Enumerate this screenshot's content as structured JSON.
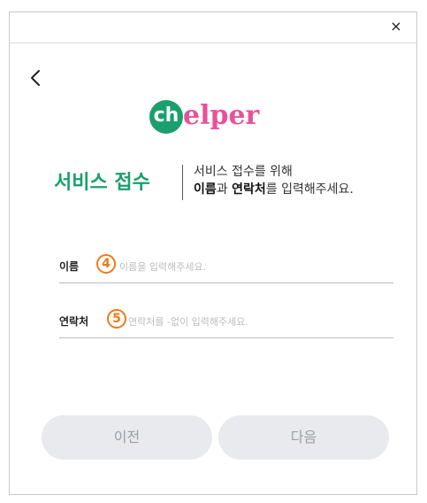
{
  "window": {
    "close_label": "×"
  },
  "logo": {
    "badge_text": "ch",
    "rest_text": "elper"
  },
  "header": {
    "title": "서비스 접수",
    "desc_line1": "서비스 접수를 위해",
    "desc_bold1": "이름",
    "desc_mid": "과 ",
    "desc_bold2": "연락처",
    "desc_end": "를 입력해주세요."
  },
  "form": {
    "name": {
      "label": "이름",
      "step": "4",
      "placeholder": "이름을 입력해주세요."
    },
    "phone": {
      "label": "연락처",
      "step": "5",
      "placeholder": "연락처를 -없이 입력해주세요."
    }
  },
  "buttons": {
    "prev": "이전",
    "next": "다음"
  },
  "colors": {
    "brand_green": "#1a9f6e",
    "brand_pink": "#e8519a",
    "step_orange": "#f07a1a",
    "button_bg": "#e8eaed"
  }
}
